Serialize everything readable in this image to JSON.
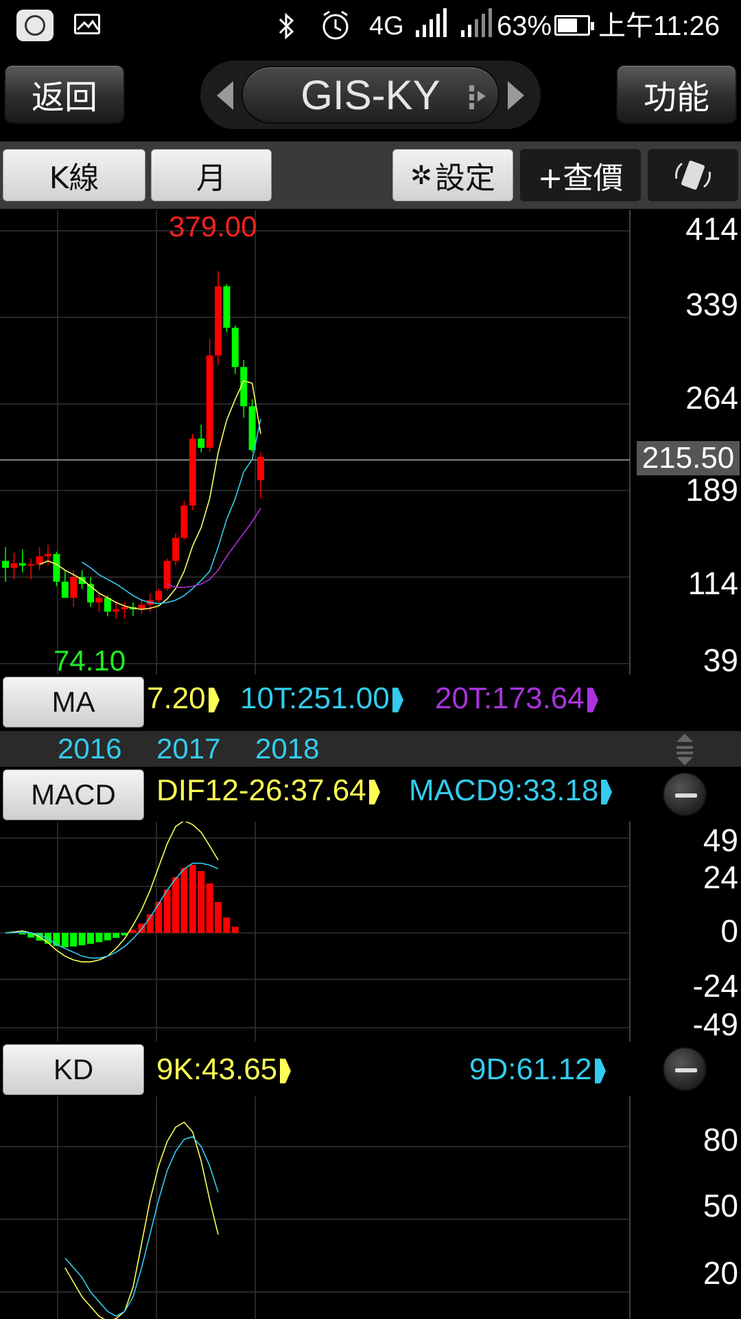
{
  "status_bar": {
    "network": "4G",
    "battery": "63%",
    "time": "上午11:26",
    "icons": [
      "mi-icon",
      "gallery-icon",
      "bluetooth-icon",
      "alarm-icon",
      "signal-sim1-icon",
      "signal-sim2-icon",
      "battery-icon"
    ]
  },
  "header": {
    "back_label": "返回",
    "stock_name": "GIS-KY",
    "function_label": "功能"
  },
  "toolbar": {
    "chart_type": "K線",
    "period": "月",
    "settings_label": "設定",
    "add_quote_label": "+查價"
  },
  "colors": {
    "up": "#ff0000",
    "down": "#00ff00",
    "ma5": "#ffff66",
    "ma10": "#33ccee",
    "ma20": "#aa33dd",
    "dif": "#ffff55",
    "macd": "#33ccee",
    "k": "#ffff55",
    "d": "#33ccee"
  },
  "price_panel": {
    "y_labels": [
      "414",
      "339",
      "264",
      "189",
      "114",
      "39"
    ],
    "high_label": "379.00",
    "low_label": "74.10",
    "current_price": "215.50"
  },
  "ma_bar": {
    "button": "MA",
    "ma5_text": "7.20",
    "ma10_text": "10T:251.00",
    "ma20_text": "20T:173.64"
  },
  "time_axis": {
    "years": [
      "2016",
      "2017",
      "2018"
    ]
  },
  "macd_bar": {
    "button": "MACD",
    "dif_text": "DIF12-26:37.64",
    "macd_text": "MACD9:33.18"
  },
  "macd_panel": {
    "y_labels": [
      "49",
      "24",
      "0",
      "-24",
      "-49"
    ]
  },
  "kd_bar": {
    "button": "KD",
    "k_text": "9K:43.65",
    "d_text": "9D:61.12"
  },
  "kd_panel": {
    "y_labels": [
      "80",
      "50",
      "20"
    ]
  },
  "chart_data": [
    {
      "type": "candlestick",
      "title": "",
      "ylim": [
        39,
        414
      ],
      "y_ticks": [
        414,
        339,
        264,
        189,
        114,
        39
      ],
      "x_tick_labels": [
        "2016",
        "2017",
        "2018"
      ],
      "candles": [
        {
          "o": 128,
          "h": 140,
          "l": 110,
          "c": 122
        },
        {
          "o": 122,
          "h": 135,
          "l": 112,
          "c": 126
        },
        {
          "o": 126,
          "h": 138,
          "l": 118,
          "c": 124
        },
        {
          "o": 124,
          "h": 130,
          "l": 112,
          "c": 125
        },
        {
          "o": 125,
          "h": 140,
          "l": 120,
          "c": 132
        },
        {
          "o": 132,
          "h": 142,
          "l": 124,
          "c": 134
        },
        {
          "o": 134,
          "h": 136,
          "l": 106,
          "c": 110
        },
        {
          "o": 110,
          "h": 120,
          "l": 96,
          "c": 96
        },
        {
          "o": 96,
          "h": 120,
          "l": 88,
          "c": 114
        },
        {
          "o": 114,
          "h": 120,
          "l": 104,
          "c": 108
        },
        {
          "o": 108,
          "h": 114,
          "l": 88,
          "c": 92
        },
        {
          "o": 92,
          "h": 100,
          "l": 84,
          "c": 96
        },
        {
          "o": 96,
          "h": 98,
          "l": 80,
          "c": 84
        },
        {
          "o": 84,
          "h": 92,
          "l": 78,
          "c": 86
        },
        {
          "o": 86,
          "h": 92,
          "l": 78,
          "c": 88
        },
        {
          "o": 88,
          "h": 92,
          "l": 80,
          "c": 86
        },
        {
          "o": 86,
          "h": 94,
          "l": 82,
          "c": 90
        },
        {
          "o": 90,
          "h": 100,
          "l": 84,
          "c": 94
        },
        {
          "o": 94,
          "h": 104,
          "l": 92,
          "c": 102
        },
        {
          "o": 104,
          "h": 130,
          "l": 102,
          "c": 128
        },
        {
          "o": 128,
          "h": 152,
          "l": 124,
          "c": 148
        },
        {
          "o": 148,
          "h": 180,
          "l": 146,
          "c": 176
        },
        {
          "o": 176,
          "h": 238,
          "l": 172,
          "c": 234
        },
        {
          "o": 234,
          "h": 246,
          "l": 222,
          "c": 226
        },
        {
          "o": 226,
          "h": 320,
          "l": 222,
          "c": 306
        },
        {
          "o": 306,
          "h": 379,
          "l": 298,
          "c": 366
        },
        {
          "o": 366,
          "h": 368,
          "l": 326,
          "c": 330
        },
        {
          "o": 330,
          "h": 332,
          "l": 290,
          "c": 296
        },
        {
          "o": 296,
          "h": 302,
          "l": 252,
          "c": 262
        },
        {
          "o": 262,
          "h": 268,
          "l": 222,
          "c": 224
        },
        {
          "o": 198,
          "h": 222,
          "l": 182,
          "c": 218
        }
      ],
      "series": [
        {
          "name": "",
          "values": [
            null,
            null,
            null,
            null,
            125,
            128,
            125,
            120,
            116,
            112,
            106,
            100,
            96,
            92,
            89,
            87,
            86,
            87,
            89,
            95,
            104,
            119,
            141,
            157,
            182,
            222,
            250,
            268,
            284,
            282,
            238
          ]
        },
        {
          "name": "10T",
          "values": [
            null,
            null,
            null,
            null,
            null,
            null,
            null,
            null,
            null,
            127,
            122,
            116,
            112,
            108,
            103,
            98,
            94,
            92,
            91,
            92,
            94,
            98,
            104,
            111,
            119,
            140,
            164,
            182,
            205,
            216,
            251
          ]
        },
        {
          "name": "20T",
          "values": [
            null,
            null,
            null,
            null,
            null,
            null,
            null,
            null,
            null,
            null,
            null,
            null,
            null,
            null,
            null,
            null,
            null,
            null,
            null,
            108,
            105,
            105,
            106,
            108,
            112,
            120,
            132,
            142,
            152,
            162,
            173.64
          ]
        }
      ]
    },
    {
      "type": "bar",
      "title": "",
      "ylim": [
        -49,
        49
      ],
      "y_ticks": [
        49,
        24,
        0,
        -24,
        -49
      ],
      "osc": [
        0,
        0,
        -0.5,
        -1.5,
        -2.5,
        -3.5,
        -4.2,
        -4.6,
        -4.4,
        -4,
        -3.5,
        -3,
        -2.4,
        -1.6,
        -0.8,
        1,
        3,
        6,
        10,
        14,
        18,
        21,
        22,
        20,
        16,
        10,
        5,
        2,
        0,
        0,
        0
      ],
      "series": [
        {
          "name": "DIF12-26",
          "values": [
            0,
            0.5,
            1,
            0,
            -2,
            -5,
            -9,
            -12,
            -14,
            -15,
            -15,
            -14,
            -12,
            -8,
            -3,
            4,
            12,
            22,
            34,
            46,
            55,
            58,
            56,
            52,
            45,
            37.64
          ]
        },
        {
          "name": "MACD9",
          "values": [
            0,
            0.2,
            0.5,
            0,
            -1,
            -3,
            -6,
            -8,
            -10,
            -12,
            -13,
            -13,
            -12,
            -10,
            -7,
            -3,
            2,
            8,
            15,
            22,
            28,
            33,
            36,
            36,
            35,
            33.18
          ]
        }
      ]
    },
    {
      "type": "line",
      "title": "",
      "ylim": [
        10,
        95
      ],
      "y_ticks": [
        80,
        50,
        20
      ],
      "series": [
        {
          "name": "9K",
          "values": [
            null,
            null,
            null,
            null,
            null,
            null,
            null,
            30,
            24,
            18,
            14,
            10,
            8,
            9,
            12,
            22,
            40,
            58,
            72,
            82,
            88,
            90,
            86,
            74,
            58,
            43.65
          ]
        },
        {
          "name": "9D",
          "values": [
            null,
            null,
            null,
            null,
            null,
            null,
            null,
            34,
            30,
            26,
            20,
            16,
            12,
            10,
            12,
            18,
            30,
            44,
            58,
            70,
            78,
            83,
            84,
            80,
            72,
            61.12
          ]
        }
      ]
    }
  ]
}
